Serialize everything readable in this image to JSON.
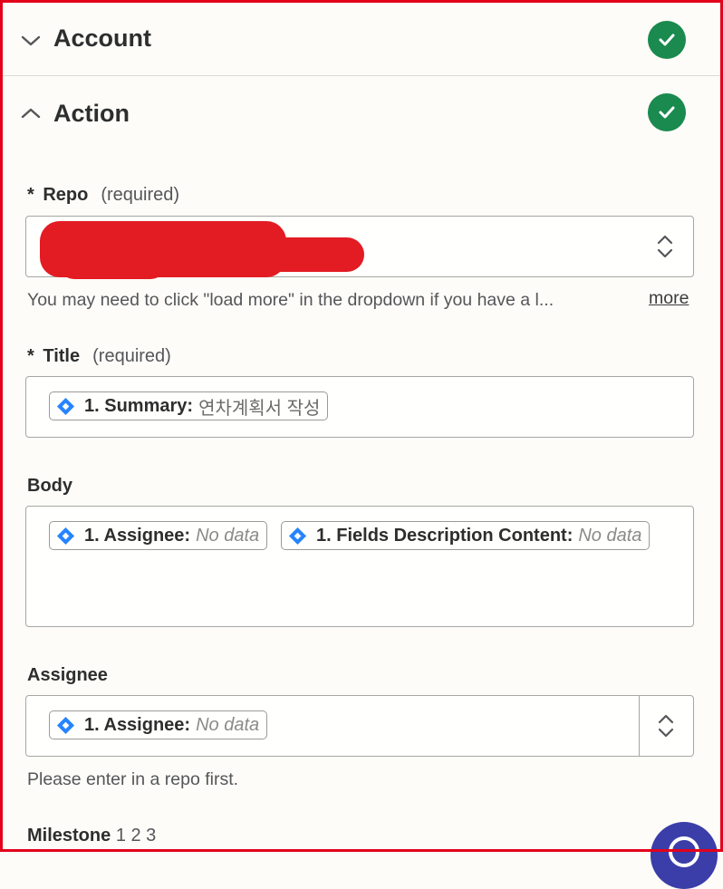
{
  "sections": {
    "account": {
      "title": "Account",
      "expanded": false,
      "status": "complete"
    },
    "action": {
      "title": "Action",
      "expanded": true,
      "status": "complete"
    }
  },
  "fields": {
    "repo": {
      "asterisk": "*",
      "label": "Repo",
      "required": "(required)",
      "help": "You may need to click \"load more\" in the dropdown if you have a l...",
      "more": "more"
    },
    "title": {
      "asterisk": "*",
      "label": "Title",
      "required": "(required)",
      "pill": {
        "key": "1. Summary:",
        "value": "연차계획서 작성"
      }
    },
    "body": {
      "label": "Body",
      "pills": [
        {
          "key": "1. Assignee:",
          "value": "No data"
        },
        {
          "key": "1. Fields Description Content:",
          "value": "No data"
        }
      ]
    },
    "assignee": {
      "label": "Assignee",
      "pill": {
        "key": "1. Assignee:",
        "value": "No data"
      },
      "help": "Please enter in a repo first."
    },
    "milestone": {
      "label": "Milestone",
      "pages": "1 2 3"
    }
  },
  "colors": {
    "check_green": "#1a8a4f",
    "jira_blue": "#2684ff",
    "frame_red": "#e3001b",
    "fab": "#3b3ea8"
  },
  "icons": [
    "chevron-down-icon",
    "chevron-up-icon",
    "check-circle-icon",
    "jira-diamond-icon",
    "up-down-arrows-icon",
    "help-icon"
  ]
}
